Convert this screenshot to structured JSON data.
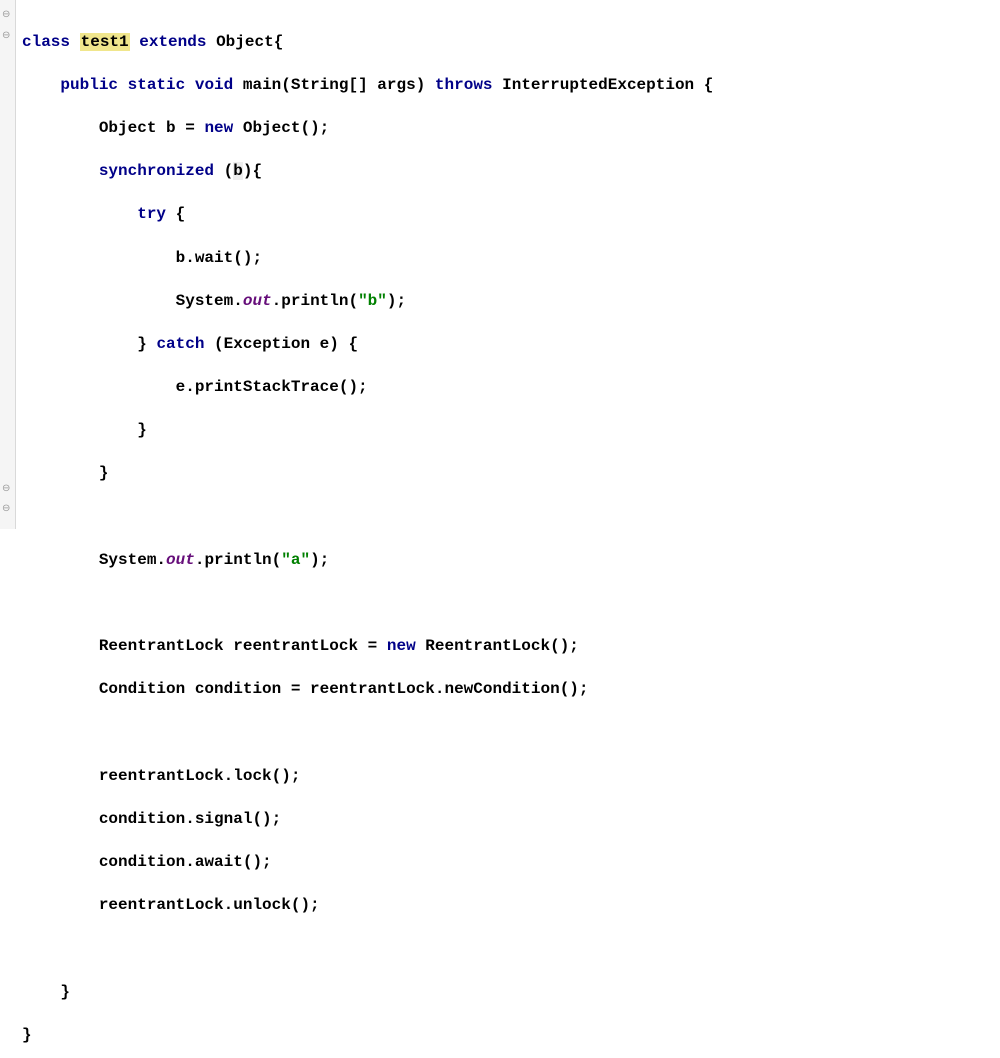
{
  "code": {
    "kw_class": "class",
    "class_name": "test1",
    "kw_extends": "extends",
    "super_class": "Object",
    "brace_open": "{",
    "brace_close": "}",
    "kw_public": "public",
    "kw_static": "static",
    "kw_void": "void",
    "method_name": "main",
    "param_type": "String[]",
    "param_name": "args",
    "kw_throws": "throws",
    "exc_type": "InterruptedException",
    "line3_left": "Object b = ",
    "kw_new": "new",
    "line3_right": " Object();",
    "kw_sync": "synchronized",
    "sync_expr_open": " (",
    "sync_var": "b",
    "sync_expr_close": "){",
    "kw_try": "try",
    "try_open": " {",
    "line6": "b.wait();",
    "line7a": "System.",
    "out_field": "out",
    "line7b": ".println(",
    "str_b": "\"b\"",
    "line7c": ");",
    "close_brace": "}",
    "kw_catch": "catch",
    "catch_decl": " (Exception e) {",
    "line9": "e.printStackTrace();",
    "line13a": "System.",
    "line13b": ".println(",
    "str_a": "\"a\"",
    "line13c": ");",
    "line15a": "ReentrantLock reentrantLock = ",
    "line15b": " ReentrantLock();",
    "line16": "Condition condition = reentrantLock.newCondition();",
    "line18": "reentrantLock.lock();",
    "line19": "condition.signal();",
    "line20": "condition.await();",
    "line21": "reentrantLock.unlock();"
  }
}
